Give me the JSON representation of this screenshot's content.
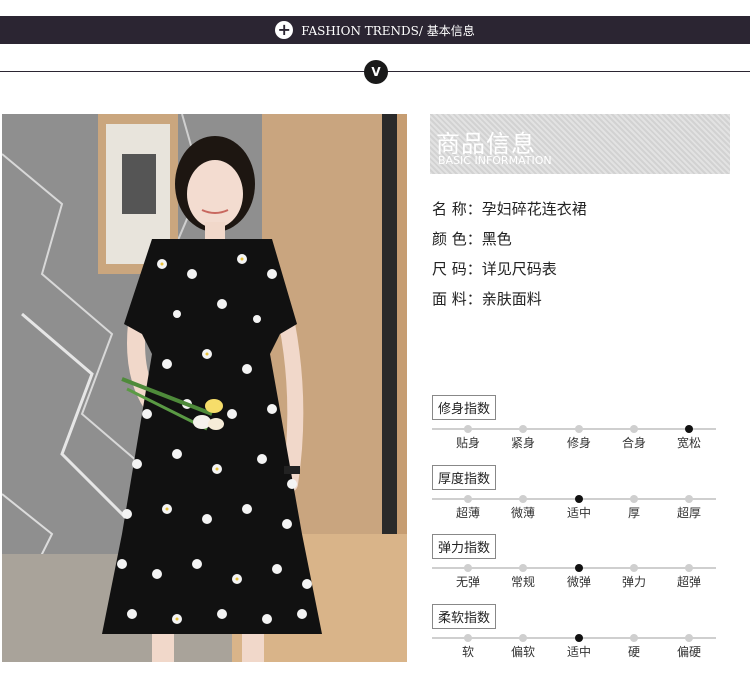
{
  "header": {
    "title": "FASHION TRENDS/ 基本信息",
    "plus_icon": "+",
    "v_icon": "V"
  },
  "info": {
    "heading_cn": "商品信息",
    "heading_en": "BASIC INFORMATION",
    "specs": [
      {
        "label": "名  称",
        "value": "孕妇碎花连衣裙"
      },
      {
        "label": "颜  色",
        "value": "黑色"
      },
      {
        "label": "尺  码",
        "value": "详见尺码表"
      },
      {
        "label": "面  料",
        "value": "亲肤面料"
      }
    ]
  },
  "ratings": [
    {
      "title": "修身指数",
      "options": [
        "贴身",
        "紧身",
        "修身",
        "合身",
        "宽松"
      ],
      "selected": 4
    },
    {
      "title": "厚度指数",
      "options": [
        "超薄",
        "微薄",
        "适中",
        "厚",
        "超厚"
      ],
      "selected": 2
    },
    {
      "title": "弹力指数",
      "options": [
        "无弹",
        "常规",
        "微弹",
        "弹力",
        "超弹"
      ],
      "selected": 2
    },
    {
      "title": "柔软指数",
      "options": [
        "软",
        "偏软",
        "适中",
        "硬",
        "偏硬"
      ],
      "selected": 2
    }
  ],
  "colors": {
    "header_bg": "#2b2532",
    "dot_active": "#111111",
    "dot_inactive": "#cfcfcf"
  }
}
